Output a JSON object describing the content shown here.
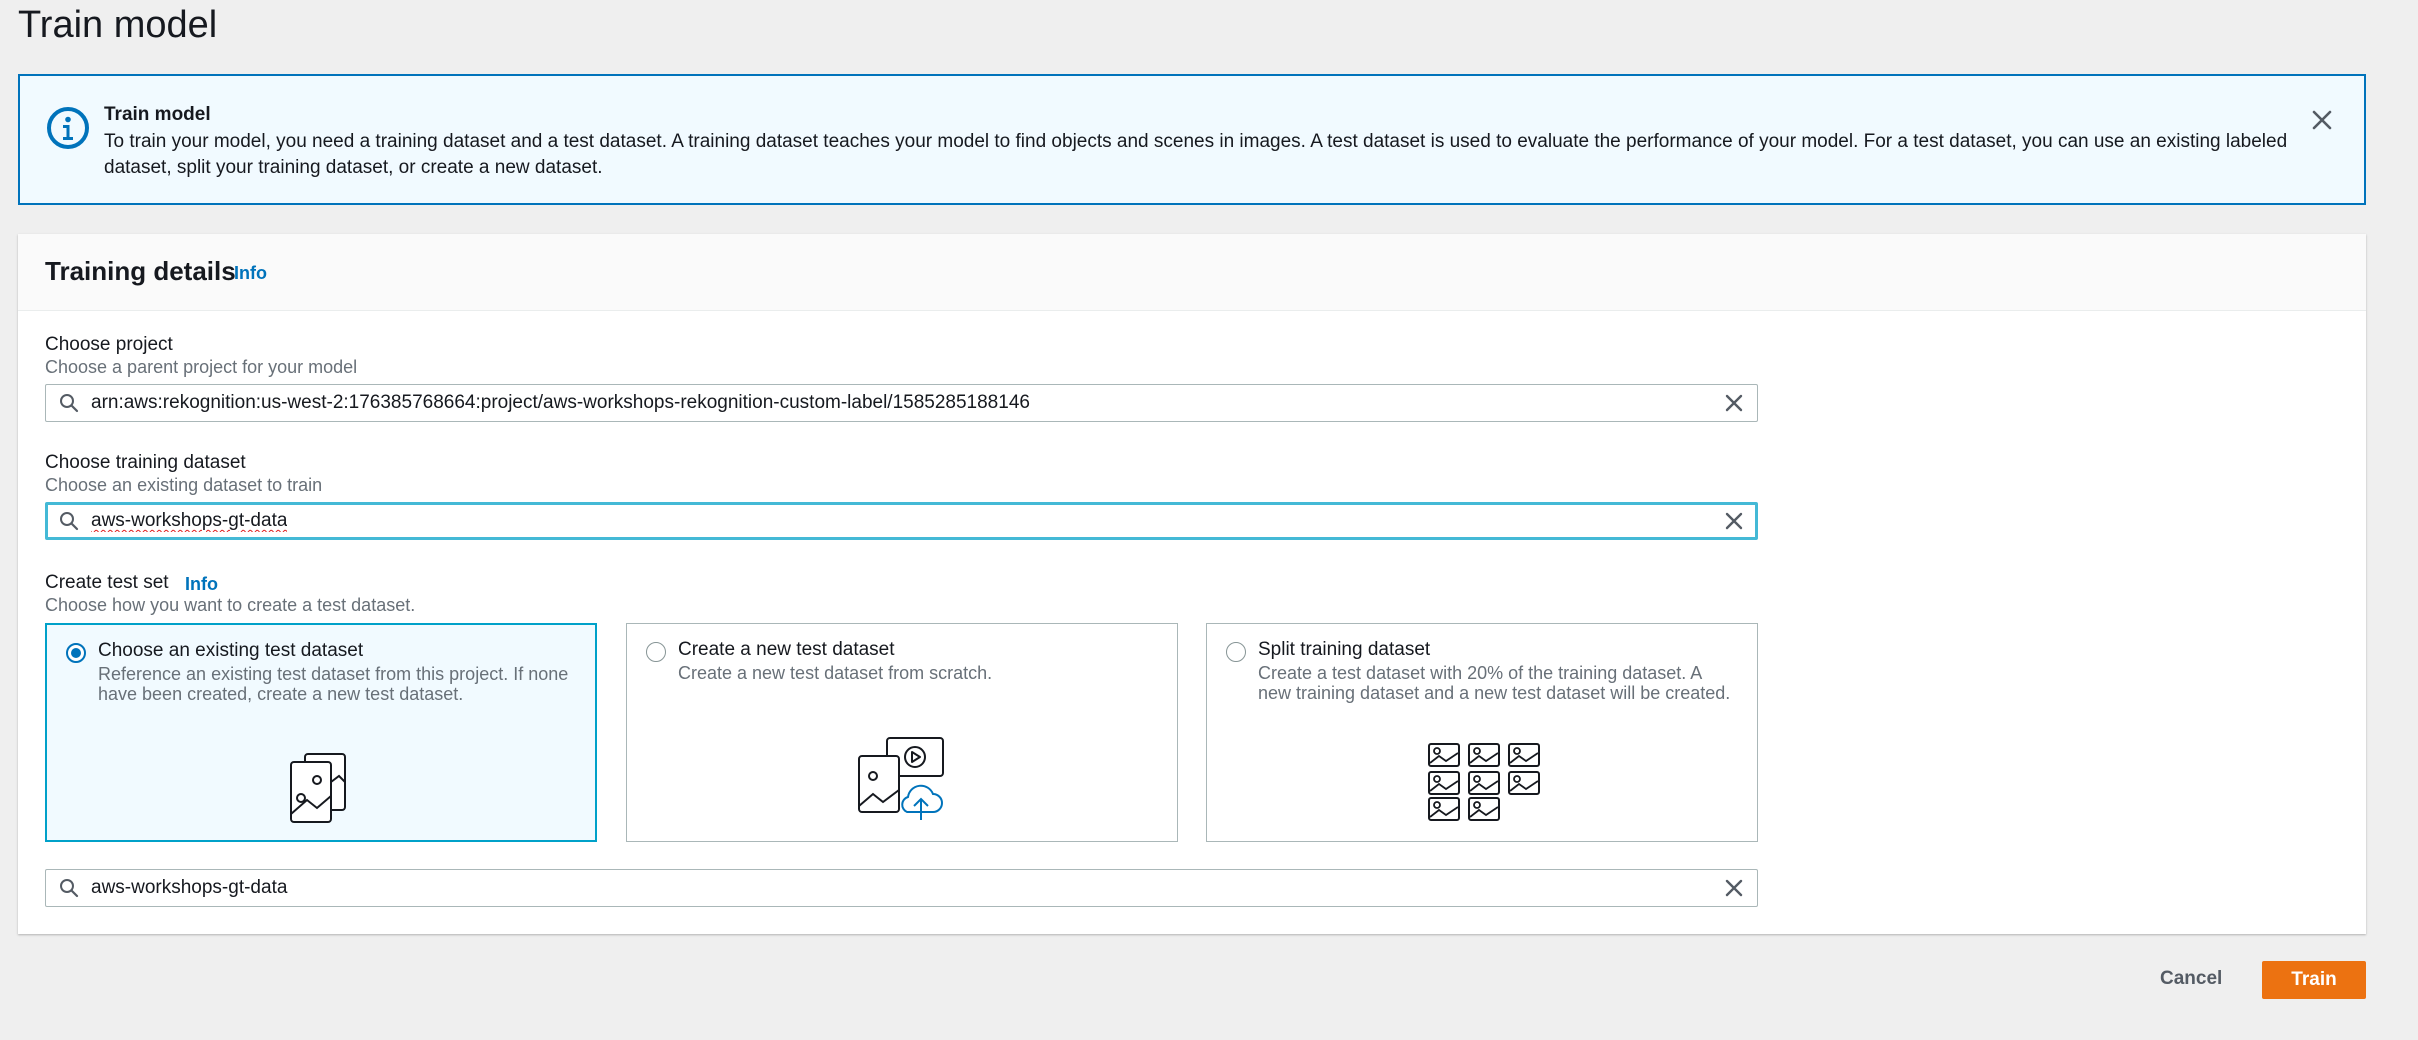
{
  "page": {
    "title": "Train model"
  },
  "banner": {
    "title": "Train model",
    "text": "To train your model, you need a training dataset and a test dataset. A training dataset teaches your model to find objects and scenes in images. A test dataset is used to evaluate the performance of your model. For a test dataset, you can use an existing labeled dataset, split your training dataset, or create a new dataset.",
    "icon": "info-circle-icon",
    "close_icon": "close-icon"
  },
  "training_details": {
    "title": "Training details",
    "info": "Info",
    "project": {
      "label": "Choose project",
      "description": "Choose a parent project for your model",
      "value": "arn:aws:rekognition:us-west-2:176385768664:project/aws-workshops-rekognition-custom-label/1585285188146"
    },
    "training_dataset": {
      "label": "Choose training dataset",
      "description": "Choose an existing dataset to train",
      "value": "aws-workshops-gt-data"
    },
    "test_set": {
      "label": "Create test set",
      "info": "Info",
      "description": "Choose how you want to create a test dataset.",
      "options": [
        {
          "title": "Choose an existing test dataset",
          "description": "Reference an existing test dataset from this project. If none have been created, create a new test dataset.",
          "selected": true
        },
        {
          "title": "Create a new test dataset",
          "description": "Create a new test dataset from scratch.",
          "selected": false
        },
        {
          "title": "Split training dataset",
          "description": "Create a test dataset with 20% of the training dataset. A new training dataset and a new test dataset will be created.",
          "selected": false
        }
      ],
      "test_dataset_value": "aws-workshops-gt-data"
    }
  },
  "footer": {
    "cancel": "Cancel",
    "train": "Train"
  },
  "colors": {
    "accent": "#0073bb",
    "primary_button": "#ec7211",
    "focus": "#44b9d6"
  }
}
